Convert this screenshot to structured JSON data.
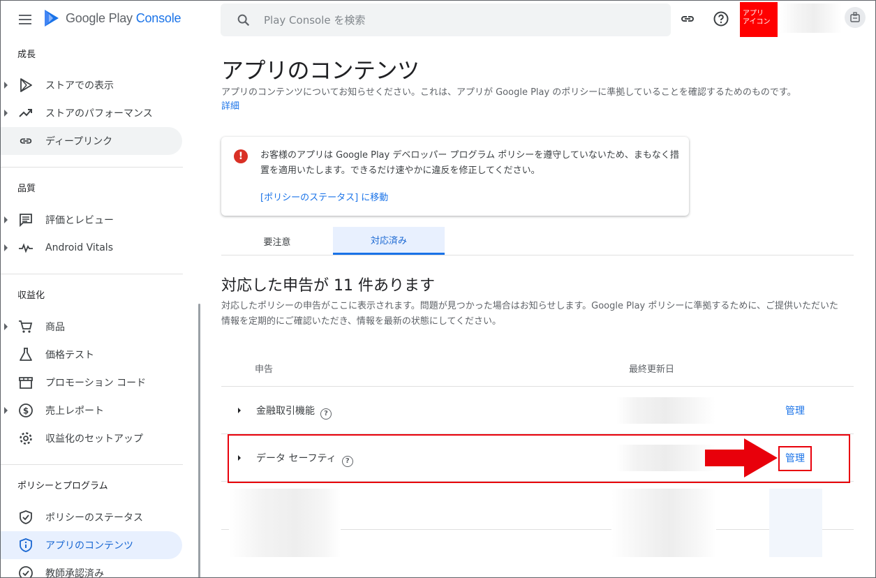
{
  "header": {
    "logo_brand": "Google Play",
    "logo_product": "Console",
    "search_placeholder": "Play Console を検索",
    "app_icon_label_line1": "アプリ",
    "app_icon_label_line2": "アイコン"
  },
  "sidebar": {
    "sections": {
      "growth": "成長",
      "quality": "品質",
      "monetize": "収益化",
      "policy": "ポリシーとプログラム"
    },
    "items": {
      "store_presence": "ストアでの表示",
      "store_performance": "ストアのパフォーマンス",
      "deep_links": "ディープリンク",
      "ratings_reviews": "評価とレビュー",
      "android_vitals": "Android Vitals",
      "products": "商品",
      "price_experiments": "価格テスト",
      "promo_codes": "プロモーション コード",
      "financial_reports": "売上レポート",
      "monetization_setup": "収益化のセットアップ",
      "policy_status": "ポリシーのステータス",
      "app_content": "アプリのコンテンツ",
      "teacher_approved": "教師承認済み"
    }
  },
  "main": {
    "title": "アプリのコンテンツ",
    "description": "アプリのコンテンツについてお知らせください。これは、アプリが Google Play のポリシーに準拠していることを確認するためのものです。",
    "details_link": "詳細",
    "alert": {
      "message": "お客様のアプリは Google Play デベロッパー プログラム ポリシーを遵守していないため、まもなく措置を適用いたします。できるだけ速やかに違反を修正してください。",
      "link": "[ポリシーのステータス] に移動"
    },
    "tabs": {
      "needs_attention": "要注意",
      "actioned": "対応済み"
    },
    "section_title_prefix": "対応した申告が ",
    "section_count": "11",
    "section_title_suffix": " 件あります",
    "section_description": "対応したポリシーの申告がここに表示されます。問題が見つかった場合はお知らせします。Google Play ポリシーに準拠するために、ご提供いただいた情報を定期的にご確認いただき、情報を最新の状態にしてください。",
    "table": {
      "col_declaration": "申告",
      "col_last_updated": "最終更新日",
      "rows": [
        {
          "label": "金融取引機能",
          "action": "管理"
        },
        {
          "label": "データ セーフティ",
          "action": "管理"
        }
      ]
    }
  },
  "colors": {
    "accent": "#1a73e8",
    "annotation_red": "#e8000b",
    "app_icon_bg": "#ff0000",
    "alert_red": "#d93025"
  }
}
